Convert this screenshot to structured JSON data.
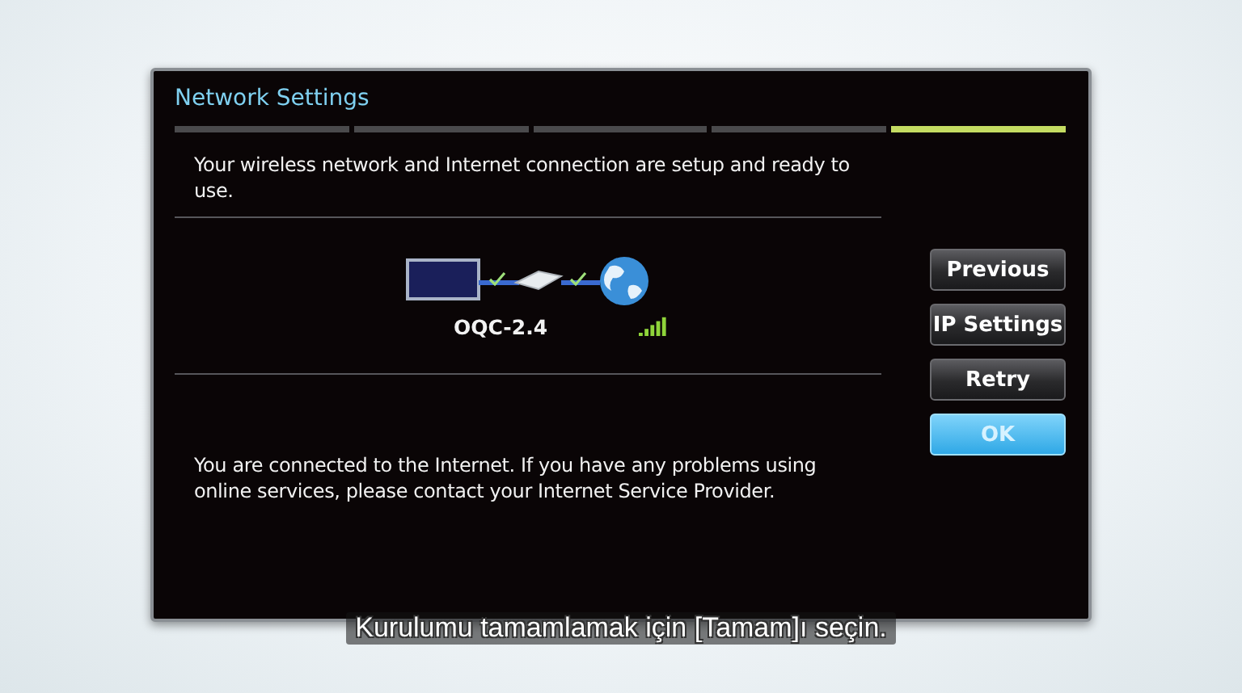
{
  "dialog": {
    "title": "Network Settings",
    "steps": [
      {
        "selected": false
      },
      {
        "selected": false
      },
      {
        "selected": false
      },
      {
        "selected": false
      },
      {
        "selected": true
      }
    ],
    "status_message": "Your wireless network and Internet connection are setup and ready to use.",
    "network_name": "OQC-2.4",
    "info_message": "You are connected to the Internet. If you have any problems using online services, please contact your Internet Service Provider.",
    "buttons": [
      {
        "label": "Previous",
        "selected": false
      },
      {
        "label": "IP Settings",
        "selected": false
      },
      {
        "label": "Retry",
        "selected": false
      },
      {
        "label": "OK",
        "selected": true
      }
    ]
  },
  "subtitle": "Kurulumu tamamlamak için [Tamam]ı seçin."
}
